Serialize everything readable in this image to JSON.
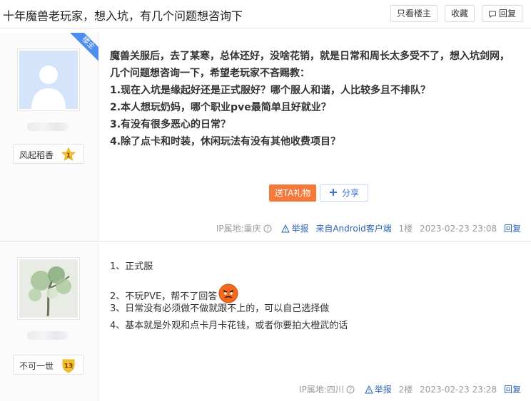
{
  "thread": {
    "title": "十年魔兽老玩家，想入坑，有几个问题想咨询下",
    "only_op_label": "只看楼主",
    "favorite_label": "收藏",
    "reply_label": "回复"
  },
  "posts": [
    {
      "author": "风起稻香",
      "level": "1",
      "op_badge": "楼主",
      "lines": [
        "魔兽关服后，去了某寒，总体还好，没啥花销，就是日常和周长太多受不了，想入坑剑网，",
        "几个问题想咨询一下，希望老玩家不吝赐教：",
        "1.现在入坑是缘起好还是正式服好？哪个服人和谐，人比较多且不排队？",
        "2.本人想玩奶妈，哪个职业pve最简单且好就业？",
        "3.有没有很多恶心的日常？",
        "4.除了点卡和时装，休闲玩法有没有其他收费项目？"
      ],
      "gift_label": "送TA礼物",
      "share_label": "分享",
      "ip": "IP属地:重庆",
      "report": "举报",
      "source": "来自Android客户端",
      "floor": "1楼",
      "time": "2023-02-23 23:08",
      "reply": "回复"
    },
    {
      "author": "不可一世",
      "level": "13",
      "lines": [
        "1、正式服",
        "2、不玩PVE，帮不了回答",
        "3、日常没有必须做不做就跟不上的，可以自己选择做",
        "4、基本就是外观和点卡月卡花钱，或者你要拍大橙武的话"
      ],
      "ip": "IP属地:四川",
      "report": "举报",
      "floor": "2楼",
      "time": "2023-02-23 23:28",
      "reply": "回复"
    }
  ],
  "icons": {
    "reply": "speech-bubble-icon",
    "help": "question-circle-icon",
    "report": "warning-triangle-icon",
    "share": "plus-icon",
    "emoji": "angry-face-icon"
  },
  "colors": {
    "gift": "#f5793a",
    "link": "#2d64b3",
    "op_badge": "#4e8ef0",
    "level_badge": "#f3c12b"
  }
}
